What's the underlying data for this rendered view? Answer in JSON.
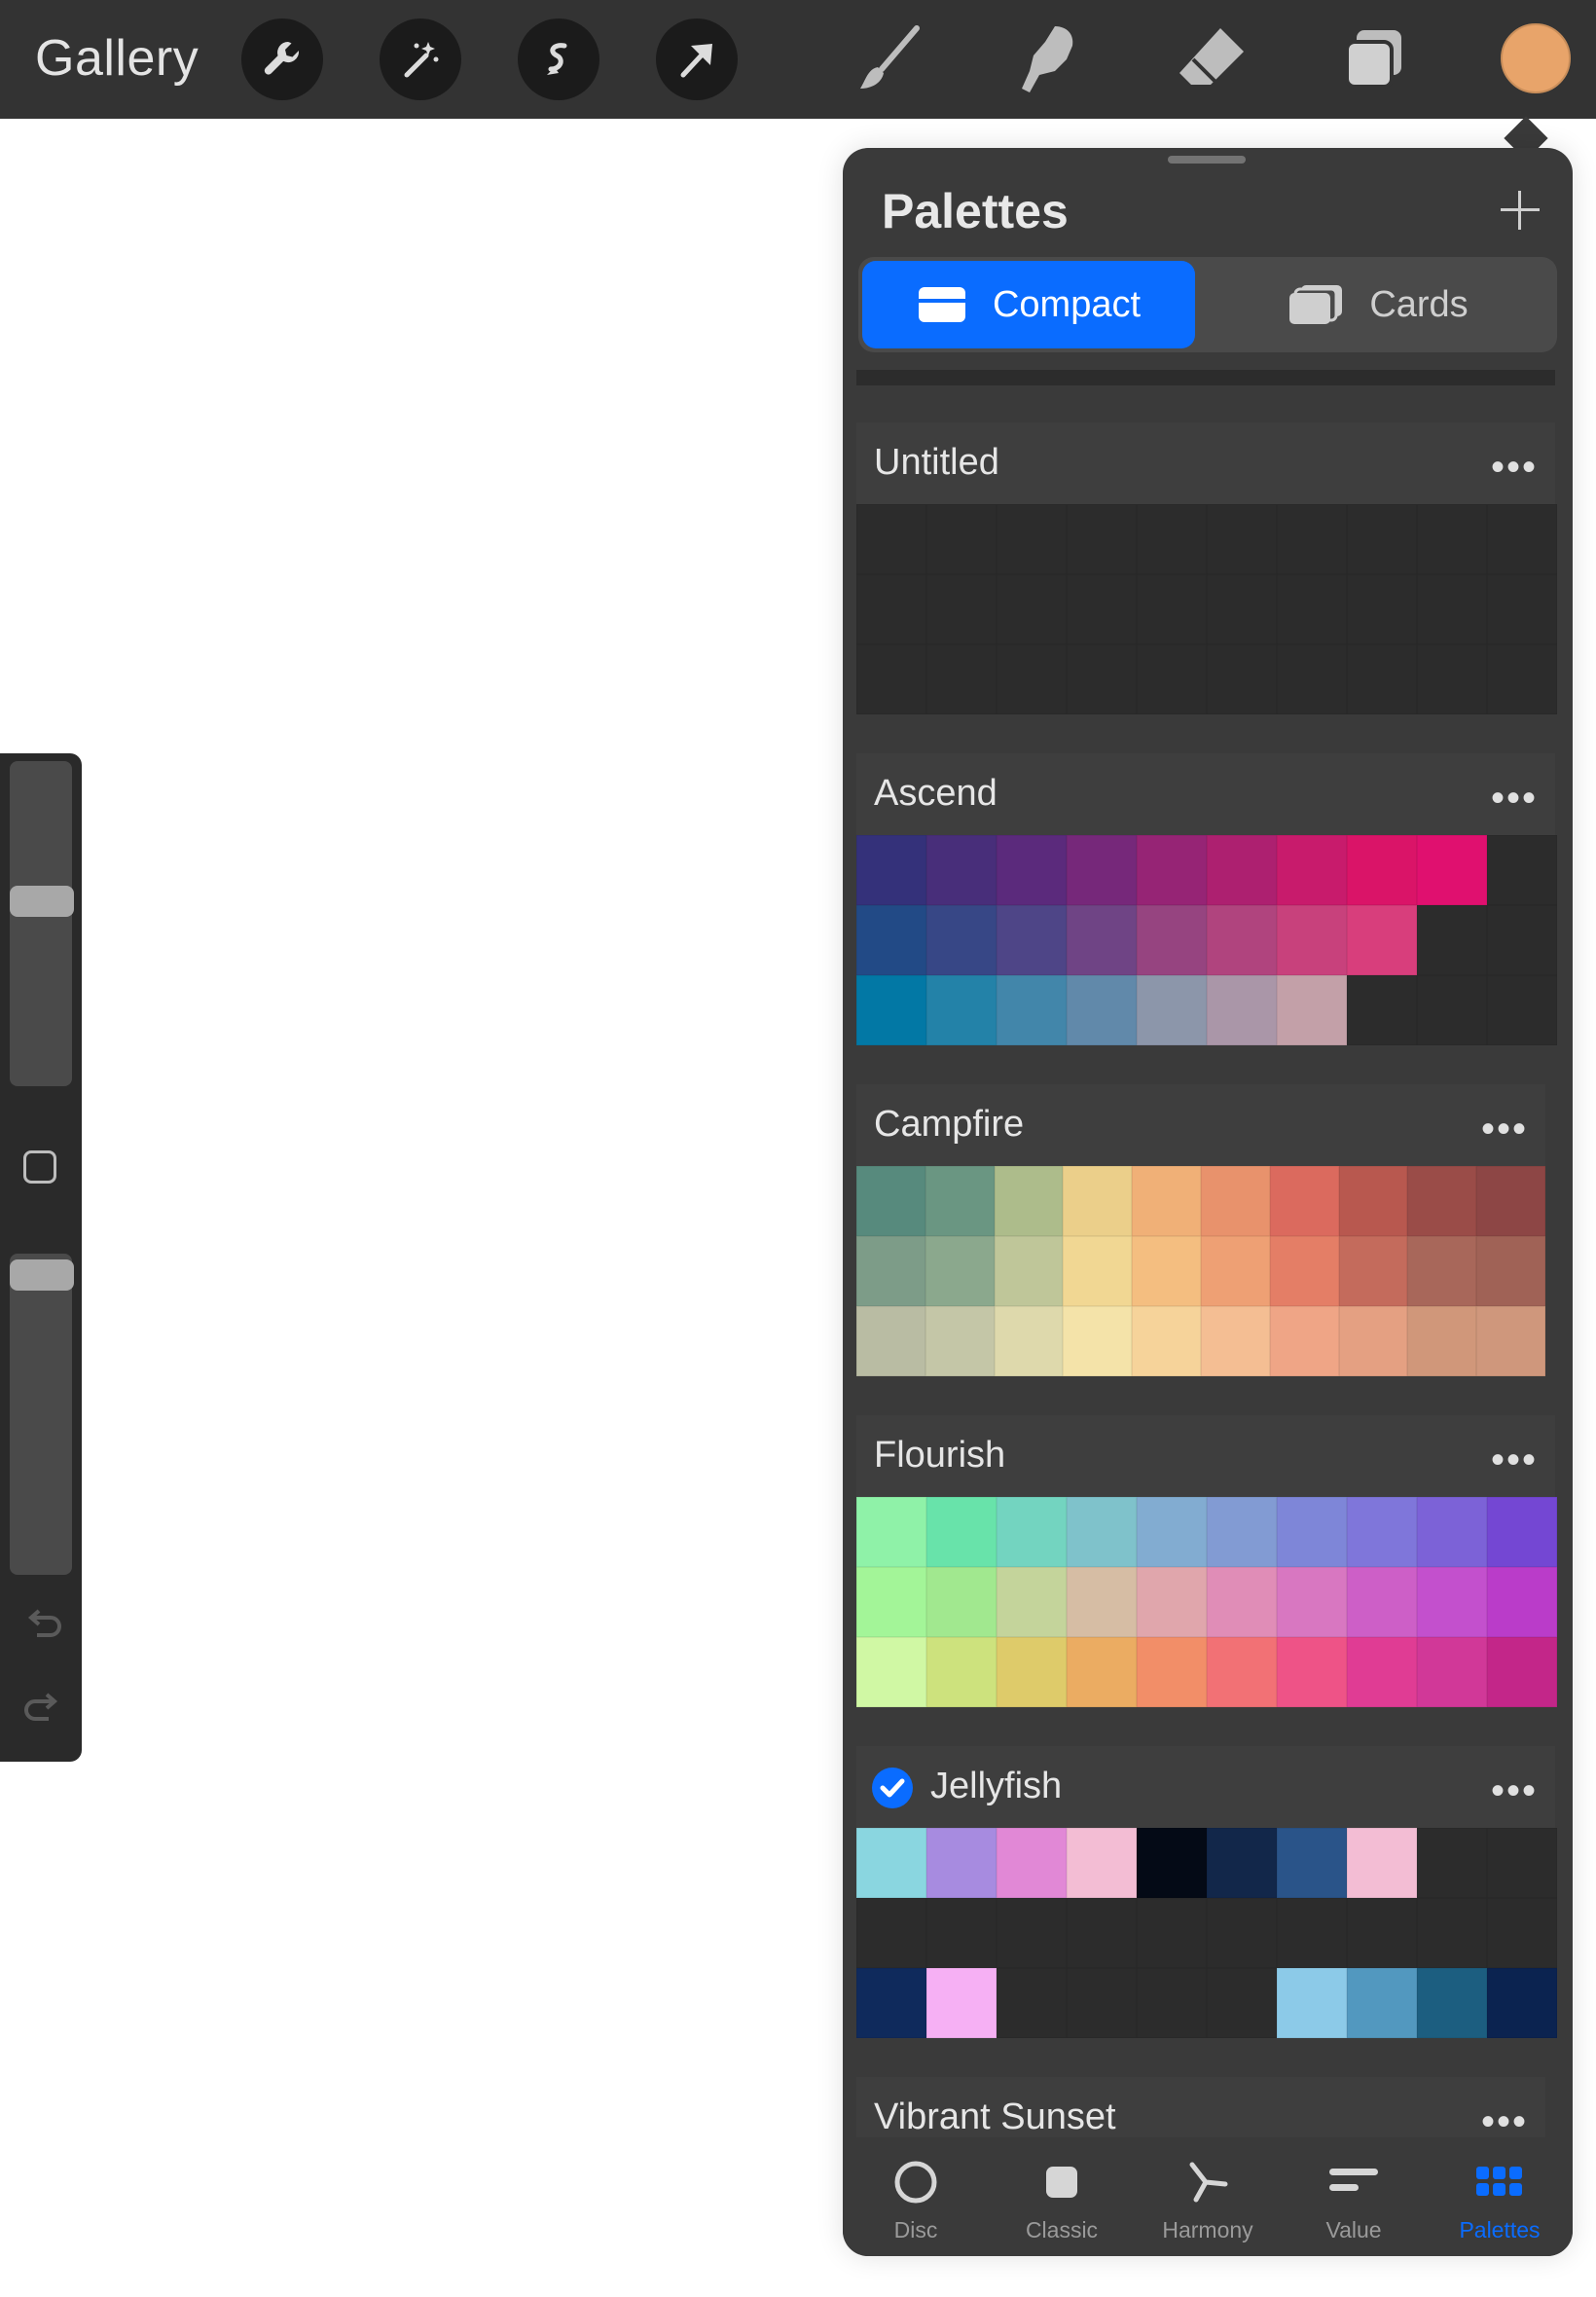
{
  "toolbar": {
    "gallery_label": "Gallery",
    "tools": [
      "wrench-icon",
      "magic-wand-icon",
      "selection-icon",
      "transform-arrow-icon",
      "brush-icon",
      "smudge-icon",
      "eraser-icon",
      "layers-icon"
    ],
    "current_color": "#E8A46A"
  },
  "palettes_panel": {
    "title": "Palettes",
    "view_modes": [
      {
        "label": "Compact",
        "active": true
      },
      {
        "label": "Cards",
        "active": false
      }
    ],
    "palettes": [
      {
        "name": "Untitled",
        "selected": false,
        "rows": [
          [
            null,
            null,
            null,
            null,
            null,
            null,
            null,
            null,
            null,
            null
          ],
          [
            null,
            null,
            null,
            null,
            null,
            null,
            null,
            null,
            null,
            null
          ],
          [
            null,
            null,
            null,
            null,
            null,
            null,
            null,
            null,
            null,
            null
          ]
        ]
      },
      {
        "name": "Ascend",
        "selected": false,
        "rows": [
          [
            "#34317A",
            "#482E7A",
            "#5B2A7C",
            "#76287A",
            "#962475",
            "#AD2070",
            "#C81B6C",
            "#DA1468",
            "#E0106F",
            null
          ],
          [
            "#224A86",
            "#374786",
            "#4E4587",
            "#6F4485",
            "#964480",
            "#B0447E",
            "#C8417C",
            "#D83E7C",
            null,
            null
          ],
          [
            "#0278A5",
            "#2382A8",
            "#4286AA",
            "#6189AA",
            "#8C96AA",
            "#AA96A8",
            "#C3A0A8",
            null,
            null,
            null
          ]
        ]
      },
      {
        "name": "Campfire",
        "selected": false,
        "rows": [
          [
            "#578A7D",
            "#6A9682",
            "#ADBC8B",
            "#EBCF8A",
            "#F0B077",
            "#E8926C",
            "#DB6A5E",
            "#B8584F",
            "#9A4C48",
            "#8D4645"
          ],
          [
            "#7D9C88",
            "#8BA88D",
            "#BFC699",
            "#F1D793",
            "#F4BE80",
            "#EEA074",
            "#E47E66",
            "#C46B5C",
            "#A8675A",
            "#A06256"
          ],
          [
            "#B9BCA3",
            "#C4C6A7",
            "#DED9AC",
            "#F4E3A9",
            "#F6D39A",
            "#F4BE93",
            "#EFA586",
            "#E4A082",
            "#D0977A",
            "#CF977C"
          ]
        ]
      },
      {
        "name": "Flourish",
        "selected": false,
        "rows": [
          [
            "#8FF2A8",
            "#68E3AA",
            "#73D4C0",
            "#7FC2CB",
            "#82ACD1",
            "#829BD3",
            "#7E86D8",
            "#7F76DA",
            "#7C62D7",
            "#7447D3"
          ],
          [
            "#A3F598",
            "#A1E88F",
            "#C4D49B",
            "#D6BDA4",
            "#E0A6AC",
            "#E08DB7",
            "#D877C1",
            "#CD5FC7",
            "#C350CD",
            "#BA3CC9"
          ],
          [
            "#D0F8A4",
            "#CDE27D",
            "#DECB6A",
            "#EBAC62",
            "#F28E68",
            "#F27175",
            "#EE5387",
            "#E03C94",
            "#D13898",
            "#C32689"
          ]
        ]
      },
      {
        "name": "Jellyfish",
        "selected": true,
        "rows": [
          [
            "#8AD6E0",
            "#A78BE0",
            "#E188D6",
            "#F3BDD4",
            "#040A16",
            "#12274A",
            "#2A5489",
            "#F3BDD4",
            null,
            null
          ],
          [
            null,
            null,
            null,
            null,
            null,
            null,
            null,
            null,
            null,
            null
          ],
          [
            "#0F2A5C",
            "#F6B0F4",
            null,
            null,
            null,
            null,
            "#8CCAE8",
            "#5298BF",
            "#1C5E80",
            "#0B2350"
          ]
        ]
      },
      {
        "name": "Vibrant Sunset",
        "selected": false,
        "rows": []
      }
    ],
    "color_modes": [
      {
        "label": "Disc",
        "icon": "disc-icon",
        "active": false
      },
      {
        "label": "Classic",
        "icon": "classic-square-icon",
        "active": false
      },
      {
        "label": "Harmony",
        "icon": "harmony-icon",
        "active": false
      },
      {
        "label": "Value",
        "icon": "value-sliders-icon",
        "active": false
      },
      {
        "label": "Palettes",
        "icon": "palettes-grid-icon",
        "active": true
      }
    ]
  },
  "colors": {
    "accent": "#0A6CFF",
    "toolbar_bg": "#333333",
    "panel_bg": "#3A3A3A",
    "empty_swatch": "#2C2C2C"
  }
}
